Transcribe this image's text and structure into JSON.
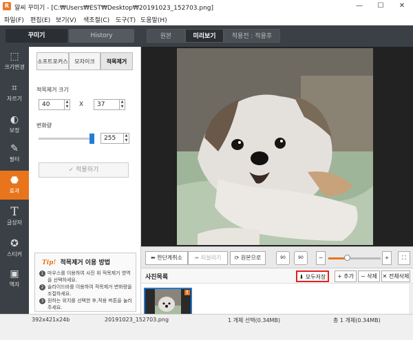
{
  "window": {
    "title": "알씨 꾸미기 - [C:₩Users₩EST₩Desktop₩20191023_152703.png]",
    "minimize_glyph": "—",
    "maximize_glyph": "☐",
    "close_glyph": "✕"
  },
  "menu": [
    "파일(F)",
    "편집(E)",
    "보기(V)",
    "색조절(C)",
    "도구(T)",
    "도움말(H)"
  ],
  "top_tabs": {
    "decorate": "꾸미기",
    "history": "History"
  },
  "view_tabs": {
    "original": "원본",
    "preview": "미리보기",
    "applied": "적용전 : 적용후"
  },
  "tools": [
    {
      "label": "크기변경",
      "icon": "resize-icon",
      "glyph": "⬚"
    },
    {
      "label": "자르기",
      "icon": "crop-icon",
      "glyph": "⌗"
    },
    {
      "label": "보정",
      "icon": "adjust-icon",
      "glyph": "◐"
    },
    {
      "label": "필터",
      "icon": "filter-icon",
      "glyph": "✎"
    },
    {
      "label": "효과",
      "icon": "effect-icon",
      "glyph": "⬣"
    },
    {
      "label": "글상자",
      "icon": "text-icon",
      "glyph": "T"
    },
    {
      "label": "스티커",
      "icon": "sticker-icon",
      "glyph": "✪"
    },
    {
      "label": "액자",
      "icon": "frame-icon",
      "glyph": "▣"
    }
  ],
  "subtabs": {
    "soft_focus": "소프트포커스",
    "mosaic": "모자이크",
    "red_eye": "적목제거"
  },
  "redeye": {
    "size_label": "적목제거 크기",
    "width": "40",
    "x_sep": "X",
    "height": "37",
    "amount_label": "변화량",
    "amount": "255",
    "amount_fraction": 1.0,
    "apply_label": "✓ 적용하기"
  },
  "tip": {
    "badge": "Tip!",
    "title": "적목제거 이용 방법",
    "items": [
      {
        "num": "1",
        "text": "마우스를 이용하여 사진 위 적목제거 영역을 선택하세요."
      },
      {
        "num": "2",
        "text": "슬라이드바를 이용하여 적목제거 변화량을 조절하세요."
      },
      {
        "num": "3",
        "text": "원하는 위치를 선택한 후,적용 버튼을 눌러주세요."
      }
    ]
  },
  "controls": {
    "undo": "⬅ 한단계취소",
    "redo": "➦ 되살리기",
    "restore": "⟳ 원본으로",
    "rot_left": "90",
    "rot_right": "90",
    "zoom_minus": "−",
    "zoom_plus": "+",
    "zoom_fraction": 0.35,
    "fit_glyph": "⛶"
  },
  "photo_list": {
    "title": "사진목록",
    "save_all": "⬇ 모두저장",
    "add": "+ 추가",
    "remove": "− 삭제",
    "remove_all": "✕ 전체삭제",
    "badge": "!"
  },
  "status": {
    "dimensions": "392x421x24b",
    "filename": "20191023_152703.png",
    "selected": "1 개체 선택(0.34MB)",
    "total": "총 1 개체(0.34MB)"
  },
  "colors": {
    "accent": "#e8751c",
    "dark": "#3b4046",
    "highlight": "#e02020",
    "slider": "#1f7fd6"
  }
}
